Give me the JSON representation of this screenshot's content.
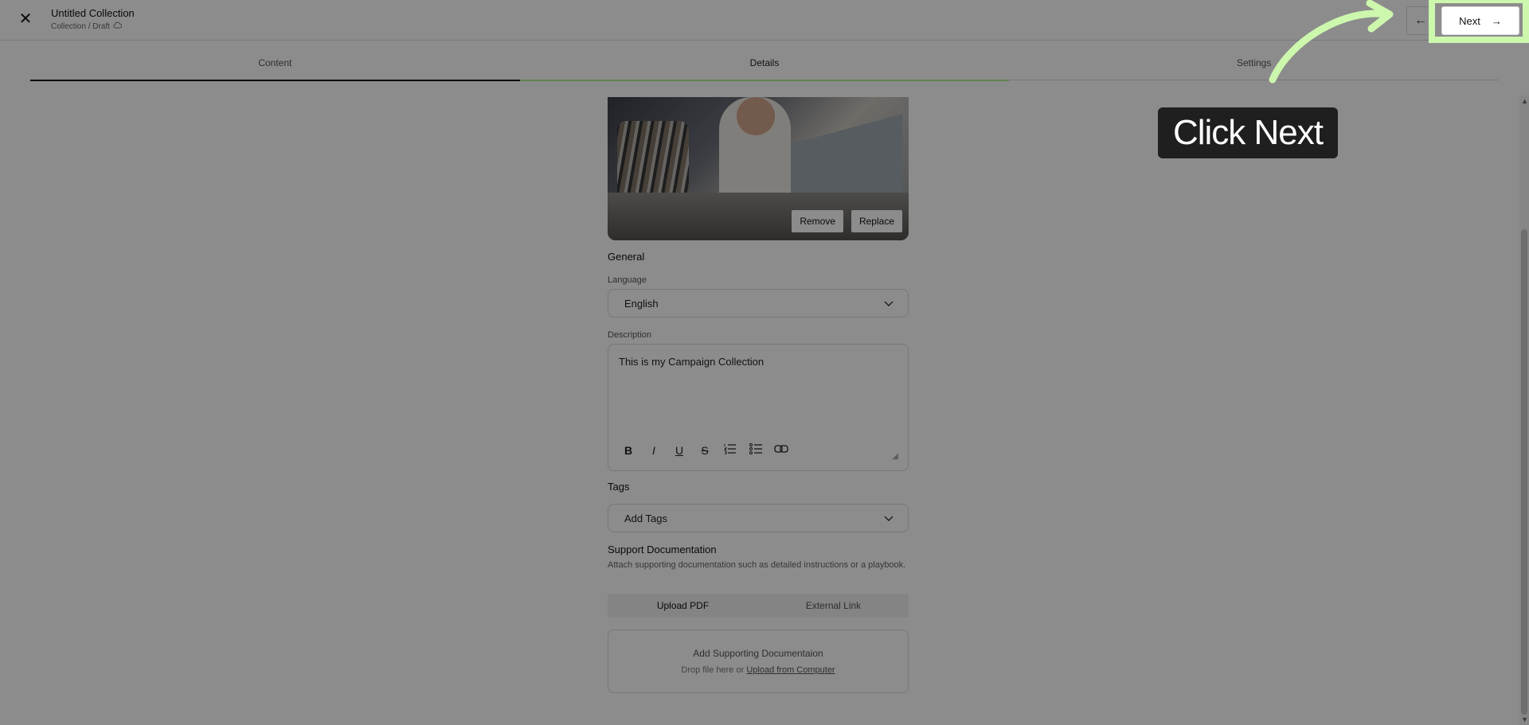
{
  "header": {
    "title": "Untitled Collection",
    "subtitle": "Collection / Draft",
    "next_label": "Next"
  },
  "tabs": [
    {
      "label": "Content"
    },
    {
      "label": "Details"
    },
    {
      "label": "Settings"
    }
  ],
  "image_buttons": {
    "remove_label": "Remove",
    "replace_label": "Replace"
  },
  "general": {
    "section_title": "General",
    "language_label": "Language",
    "language_value": "English",
    "description_label": "Description",
    "description_value": "This is my Campaign Collection"
  },
  "tags": {
    "title": "Tags",
    "placeholder": "Add Tags"
  },
  "support": {
    "title": "Support Documentation",
    "help": "Attach supporting documentation such as detailed instructions or a playbook.",
    "upload_tab": "Upload PDF",
    "link_tab": "External Link",
    "drop_title": "Add Supporting Documentaion",
    "drop_sub": "Drop file here or",
    "drop_link": "Upload from Computer"
  },
  "tooltip": {
    "text": "Click Next"
  },
  "colors": {
    "highlight": "#ccf7ad",
    "tooltip_bg": "#1f1f1f"
  }
}
